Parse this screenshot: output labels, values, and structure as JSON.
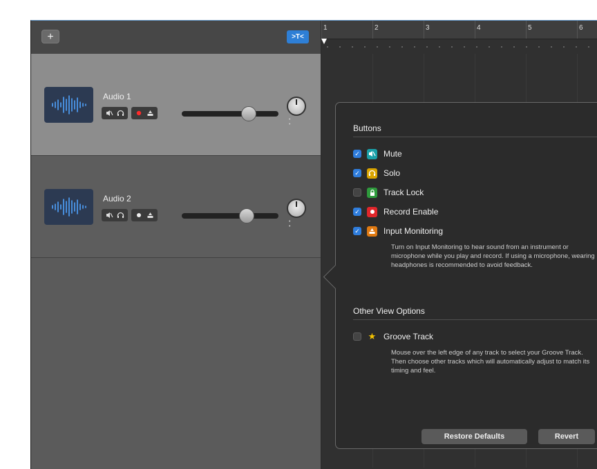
{
  "toolbar": {
    "add_track_label": "+",
    "catch_button_label": ">T<"
  },
  "tracks": [
    {
      "name": "Audio 1",
      "selected": true,
      "record_enabled": true,
      "volume_fraction": 0.73
    },
    {
      "name": "Audio 2",
      "selected": false,
      "record_enabled": false,
      "volume_fraction": 0.7
    }
  ],
  "ruler": {
    "bars": [
      "1",
      "2",
      "3",
      "4",
      "5",
      "6"
    ]
  },
  "popover": {
    "buttons_section_title": "Buttons",
    "options": [
      {
        "label": "Mute",
        "checked": true,
        "icon": "mute-icon",
        "icon_color": "#1aa0a8"
      },
      {
        "label": "Solo",
        "checked": true,
        "icon": "headphones-icon",
        "icon_color": "#d9a400"
      },
      {
        "label": "Track Lock",
        "checked": false,
        "icon": "lock-icon",
        "icon_color": "#2e9a3c"
      },
      {
        "label": "Record Enable",
        "checked": true,
        "icon": "record-icon",
        "icon_color": "#e0262b"
      },
      {
        "label": "Input Monitoring",
        "checked": true,
        "icon": "input-monitor-icon",
        "icon_color": "#e07a12"
      }
    ],
    "input_monitoring_help": "Turn on Input Monitoring to hear sound from an instrument or microphone while you play and record. If using a microphone, wearing headphones is recommended to avoid feedback.",
    "other_section_title": "Other View Options",
    "groove_track": {
      "label": "Groove Track",
      "checked": false,
      "icon": "star-icon",
      "icon_color": "#f5c400",
      "help": "Mouse over the left edge of any track to select your Groove Track. Then choose other tracks which will automatically adjust to match its timing and feel."
    },
    "restore_defaults_label": "Restore Defaults",
    "revert_label": "Revert"
  }
}
